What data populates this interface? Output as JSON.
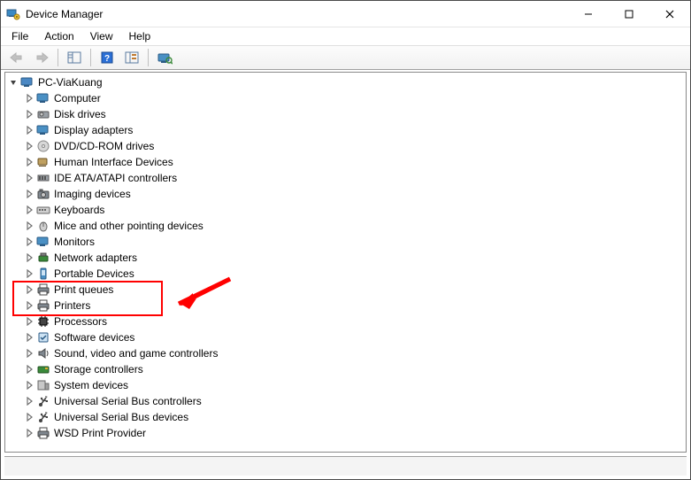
{
  "title": "Device Manager",
  "menu": {
    "file": "File",
    "action": "Action",
    "view": "View",
    "help": "Help"
  },
  "root": {
    "label": "PC-ViaKuang"
  },
  "categories": [
    {
      "id": "computer",
      "label": "Computer",
      "icon": "monitor-icon"
    },
    {
      "id": "disk-drives",
      "label": "Disk drives",
      "icon": "disk-icon"
    },
    {
      "id": "display",
      "label": "Display adapters",
      "icon": "monitor-icon"
    },
    {
      "id": "dvd",
      "label": "DVD/CD-ROM drives",
      "icon": "dvd-icon"
    },
    {
      "id": "hid",
      "label": "Human Interface Devices",
      "icon": "hid-icon"
    },
    {
      "id": "ide",
      "label": "IDE ATA/ATAPI controllers",
      "icon": "ide-icon"
    },
    {
      "id": "imaging",
      "label": "Imaging devices",
      "icon": "camera-icon"
    },
    {
      "id": "keyboards",
      "label": "Keyboards",
      "icon": "keyboard-icon"
    },
    {
      "id": "mice",
      "label": "Mice and other pointing devices",
      "icon": "mouse-icon"
    },
    {
      "id": "monitors",
      "label": "Monitors",
      "icon": "monitor-icon"
    },
    {
      "id": "network",
      "label": "Network adapters",
      "icon": "network-icon"
    },
    {
      "id": "portable",
      "label": "Portable Devices",
      "icon": "portable-icon"
    },
    {
      "id": "print-queues",
      "label": "Print queues",
      "icon": "printer-icon"
    },
    {
      "id": "printers",
      "label": "Printers",
      "icon": "printer-icon"
    },
    {
      "id": "processors",
      "label": "Processors",
      "icon": "cpu-icon"
    },
    {
      "id": "software",
      "label": "Software devices",
      "icon": "software-icon"
    },
    {
      "id": "sound",
      "label": "Sound, video and game controllers",
      "icon": "speaker-icon"
    },
    {
      "id": "storage",
      "label": "Storage controllers",
      "icon": "storage-icon"
    },
    {
      "id": "system",
      "label": "System devices",
      "icon": "system-icon"
    },
    {
      "id": "usb-ctrl",
      "label": "Universal Serial Bus controllers",
      "icon": "usb-icon"
    },
    {
      "id": "usb-dev",
      "label": "Universal Serial Bus devices",
      "icon": "usb-icon"
    },
    {
      "id": "wsd",
      "label": "WSD Print Provider",
      "icon": "printer-icon"
    }
  ],
  "annotation": {
    "highlighted_ids": [
      "print-queues",
      "printers"
    ]
  }
}
